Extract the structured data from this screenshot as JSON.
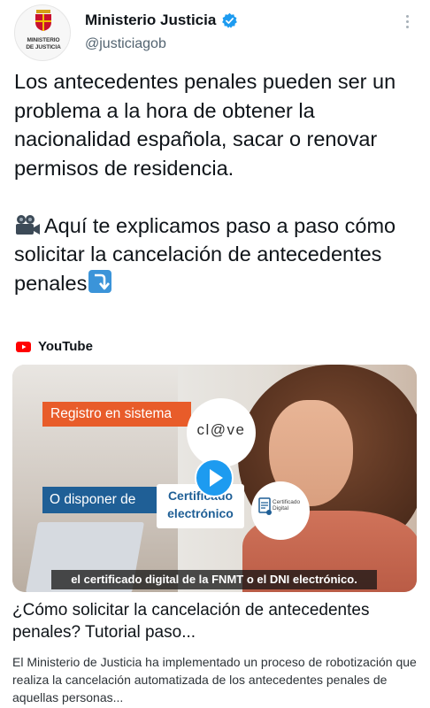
{
  "header": {
    "display_name": "Ministerio Justicia",
    "handle": "@justiciagob",
    "avatar_text": "MINISTERIO\nDE JUSTICIA"
  },
  "tweet": {
    "paragraph1": "Los antecedentes penales pueden ser un problema a la hora de obtener la nacionalidad española, sacar o renovar permisos de residencia.",
    "paragraph2": "Aquí te explicamos paso a paso cómo solicitar la cancelación de antecedentes penales"
  },
  "card": {
    "source": "YouTube",
    "video_overlays": {
      "registro": "Registro en sistema",
      "clave": "cl@ve",
      "disponer": "O disponer de",
      "cert_line1": "Certificado",
      "cert_line2": "electrónico",
      "certificado_digital": "Certificado\nDigital",
      "subtitle": "el certificado digital de la FNMT o el DNI electrónico."
    },
    "title": "¿Cómo solicitar la cancelación de antecedentes penales? Tutorial paso...",
    "description": "El Ministerio de Justicia ha implementado un proceso de robotización que realiza la cancelación automatizada de los antecedentes penales de aquellas personas..."
  },
  "icons": {
    "verified": "verified-badge-icon",
    "more": "more-options-icon",
    "camera": "movie-camera-icon",
    "arrow": "arrow-down-right-icon",
    "youtube": "youtube-icon",
    "play": "play-icon"
  },
  "colors": {
    "verified_blue": "#1d9bf0",
    "youtube_red": "#ff0000",
    "orange_tag": "#e85c2a",
    "blue_tag": "#1f5f96",
    "handle_gray": "#536471"
  }
}
